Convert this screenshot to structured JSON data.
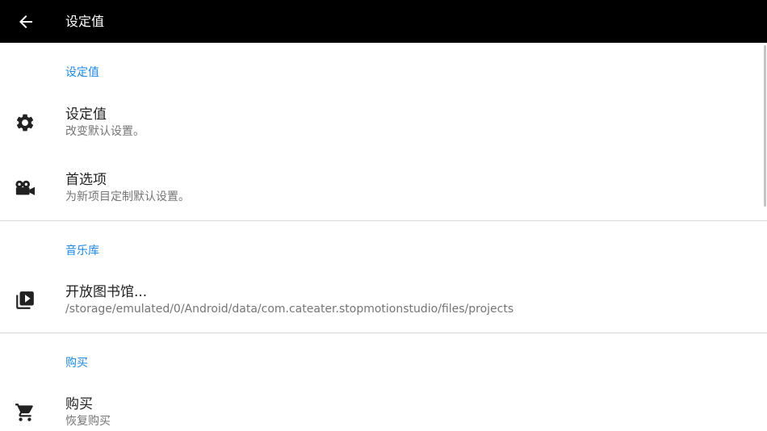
{
  "toolbar": {
    "title": "设定值",
    "back_icon": "arrow-back-icon"
  },
  "sections": [
    {
      "header": "设定值",
      "items": [
        {
          "title": "设定值",
          "summary": "改变默认设置。",
          "icon": "gear-icon"
        },
        {
          "title": "首选项",
          "summary": "为新项目定制默认设置。",
          "icon": "movie-camera-icon"
        }
      ]
    },
    {
      "header": "音乐库",
      "items": [
        {
          "title": "开放图书馆...",
          "summary": "/storage/emulated/0/Android/data/com.cateater.stopmotionstudio/files/projects",
          "icon": "video-library-icon"
        }
      ]
    },
    {
      "header": "购买",
      "items": [
        {
          "title": "购买",
          "summary": "恢复购买",
          "icon": "shopping-cart-icon"
        }
      ]
    }
  ],
  "colors": {
    "toolbar_bg": "#000000",
    "category_accent": "#1e88e5",
    "divider": "#d9d9d9",
    "title_text": "#212121",
    "summary_text": "#757575"
  }
}
